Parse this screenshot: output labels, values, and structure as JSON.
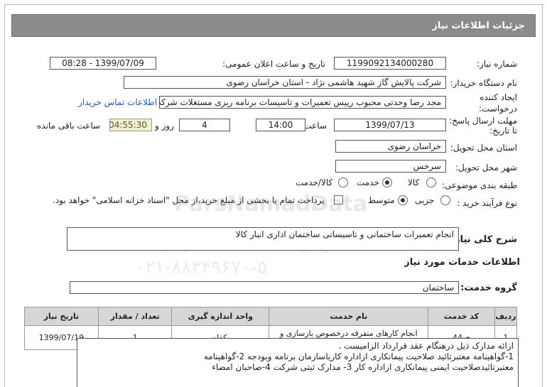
{
  "header": {
    "title": "جزئیات اطلاعات نیاز"
  },
  "fields": {
    "need_number_label": "شماره نیاز:",
    "need_number": "1199092134000280",
    "announce_label": "تاریخ و ساعت اعلان عمومی:",
    "announce_value": "1399/07/09 - 08:28",
    "buyer_label": "نام دستگاه خریدار:",
    "buyer_value": "شرکت پالایش گاز شهید هاشمی نژاد - استان خراسان رضوی",
    "creator_label_1": "ایجاد کننده",
    "creator_label_2": "درخواست:",
    "creator_value": "مجد رضا وحدتی محبوب رییس تعمیرات و تاسیسات برنامه ریزی مستغلات شرکت",
    "contact_link": "اطلاعات تماس خریدار",
    "deadline_label_1": "مهلت ارسال پاسخ:",
    "deadline_label_2": "تا تاریخ:",
    "deadline_date": "1399/07/13",
    "time_label": "ساعت",
    "deadline_time": "14:00",
    "days_value": "4",
    "days_label": "روز و",
    "remaining_time": "04:55:30",
    "remaining_label": "ساعت باقی مانده",
    "province_label": "استان محل تحویل:",
    "province_value": "خراسان رضوی",
    "city_label": "شهر محل تحویل:",
    "city_value": "سرخس",
    "category_label": "طبقه بندی موضوعی:",
    "category_options": [
      "کالا",
      "خدمت",
      "کالا/خدمت"
    ],
    "category_selected": "خدمت",
    "process_label": "نوع فرآیند خرید :",
    "process_options": [
      "جزیی",
      "متوسط"
    ],
    "process_selected": "متوسط",
    "payment_note": "پرداخت تمام یا بخشی از مبلغ خرید،از محل \"اسناد خزانه اسلامی\" خواهد بود.",
    "description_label": "شرح کلی نیاز:",
    "description_value": "انجام تعمیرات ساختمانی و تاسیساتی ساختمان اداری انبار کالا",
    "services_heading": "اطلاعات خدمات مورد نیاز",
    "service_group_label": "گروه خدمت:",
    "service_group_value": "ساختمان"
  },
  "watermark": {
    "line1": "ParsNamadData",
    "line2": "پایگاه اطلاع رسانی مناقصه ومزایده",
    "line3": "۰۲۱-۸۸۳۴۹۶۷۰-۵"
  },
  "table": {
    "headers": [
      "ردیف",
      "کد خدمت",
      "نام خدمت",
      "واحد اندازه گیری",
      "تعداد / مقدار",
      "تاریخ نیاز"
    ],
    "rows": [
      [
        "1",
        "ج-44",
        "انجام کارهای متفرقه درخصوص بازسازی و بهسازی ساختمان ها",
        "یکقلم",
        "1",
        "1399/07/19"
      ]
    ]
  },
  "notes": {
    "line1": "ارائه مدارک ذیل درهنگام عقد قرارداد الزامیست .",
    "line2": "1-گواهینامه معتبرتائید صلاحیت پیمانکاری ازاداره کاریاسازمان برنامه وبودجه 2-گواهینامه",
    "line3": "معتبرتائیدصلاحیت ایمنی پیمانکاری ازاداره کار 3- مدارک ثبتی شرکت 4-صاحبان امضاء"
  }
}
